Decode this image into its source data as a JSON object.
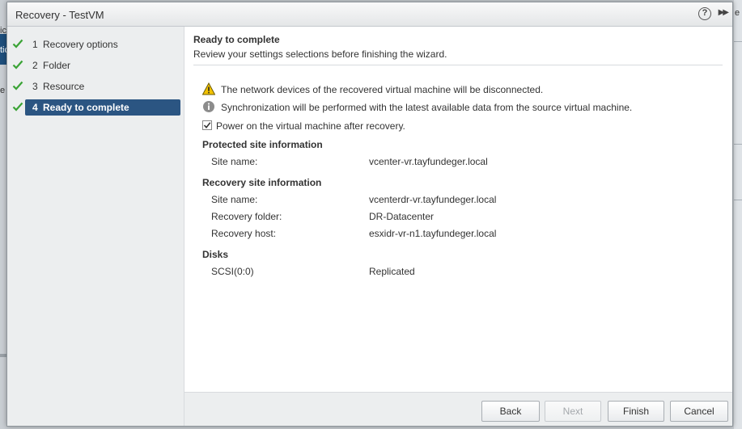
{
  "background": {
    "left_text_fragments": [
      "ic",
      "tic",
      "e"
    ],
    "right_text_fragment": "e"
  },
  "dialog": {
    "title": "Recovery - TestVM",
    "help_label": "?",
    "expand_label": "▶▶"
  },
  "steps": [
    {
      "number": "1",
      "label": "Recovery options",
      "complete": true,
      "active": false
    },
    {
      "number": "2",
      "label": "Folder",
      "complete": true,
      "active": false
    },
    {
      "number": "3",
      "label": "Resource",
      "complete": true,
      "active": false
    },
    {
      "number": "4",
      "label": "Ready to complete",
      "complete": true,
      "active": true
    }
  ],
  "page": {
    "title": "Ready to complete",
    "subtitle": "Review your settings selections before finishing the wizard."
  },
  "messages": {
    "warning": "The network devices of the recovered virtual machine will be disconnected.",
    "info": "Synchronization will be performed with the latest available data from the source virtual machine."
  },
  "power_on": {
    "label": "Power on the virtual machine after recovery.",
    "checked": true
  },
  "protected_site": {
    "heading": "Protected site information",
    "site_name_label": "Site name:",
    "site_name_value": "vcenter-vr.tayfundeger.local"
  },
  "recovery_site": {
    "heading": "Recovery site information",
    "site_name_label": "Site name:",
    "site_name_value": "vcenterdr-vr.tayfundeger.local",
    "folder_label": "Recovery folder:",
    "folder_value": "DR-Datacenter",
    "host_label": "Recovery host:",
    "host_value": "esxidr-vr-n1.tayfundeger.local"
  },
  "disks": {
    "heading": "Disks",
    "disk_label": "SCSI(0:0)",
    "disk_value": "Replicated"
  },
  "footer": {
    "back": "Back",
    "next": "Next",
    "finish": "Finish",
    "cancel": "Cancel"
  },
  "colors": {
    "active_step": "#2b5582",
    "check_green": "#3aa335",
    "warning_yellow": "#f2c200"
  }
}
